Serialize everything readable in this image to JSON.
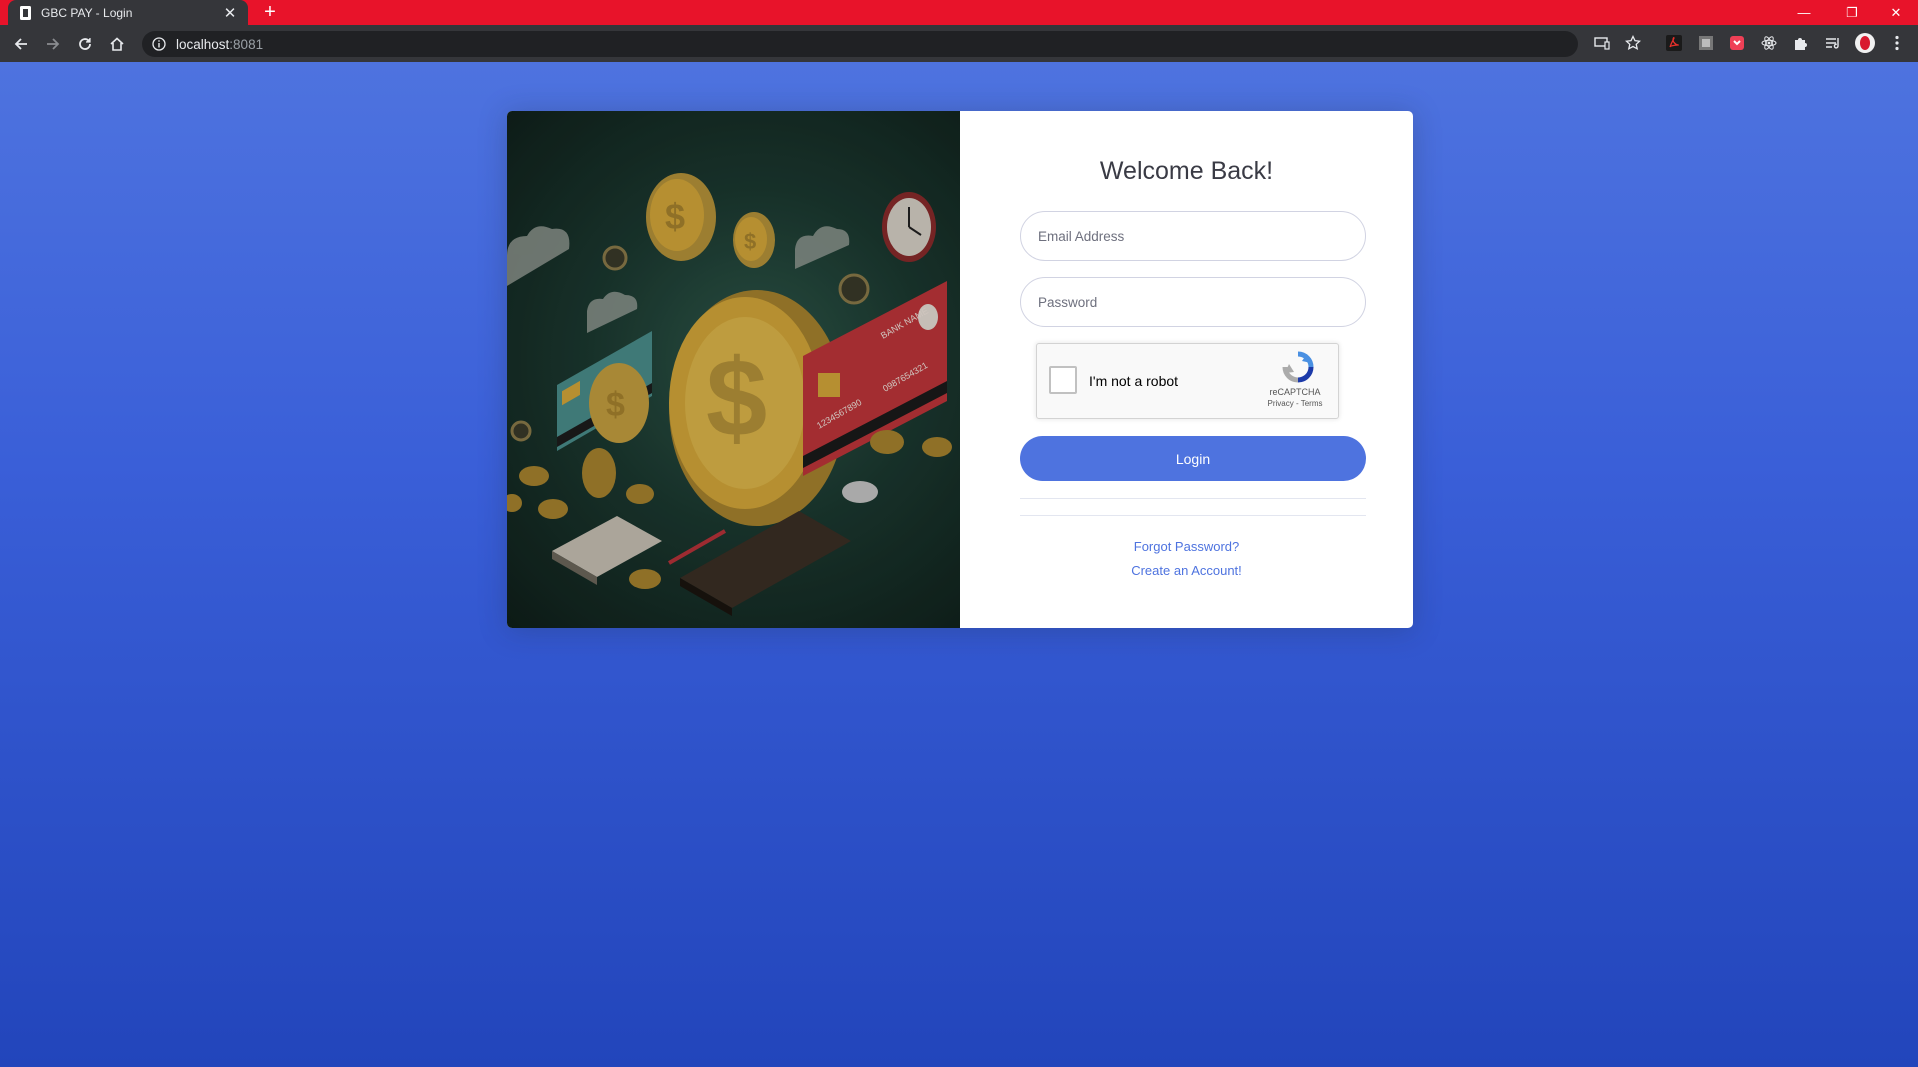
{
  "browser": {
    "tab_title": "GBC PAY - Login",
    "address_host": "localhost",
    "address_port": ":8081",
    "new_tab_symbol": "+",
    "tab_close_symbol": "✕",
    "window_controls": [
      "—",
      "❐",
      "✕"
    ]
  },
  "login": {
    "heading": "Welcome Back!",
    "email_placeholder": "Email Address",
    "password_placeholder": "Password",
    "button_label": "Login",
    "forgot_password": "Forgot Password?",
    "create_account": "Create an Account!"
  },
  "recaptcha": {
    "label": "I'm not a robot",
    "brand": "reCAPTCHA",
    "links": "Privacy - Terms"
  },
  "illustration": {
    "card_bank_name": "BANK NAME",
    "card_number_1": "1234567890",
    "card_number_2": "0987654321",
    "dollar_sign": "$",
    "colors": {
      "red_card": "#c0353a",
      "teal_card": "#4a8f8c",
      "coin": "#d6a93a"
    }
  },
  "theme": {
    "accent": "#4e73df",
    "browser_frame": "#e8132a",
    "toolbar": "#35363a"
  }
}
